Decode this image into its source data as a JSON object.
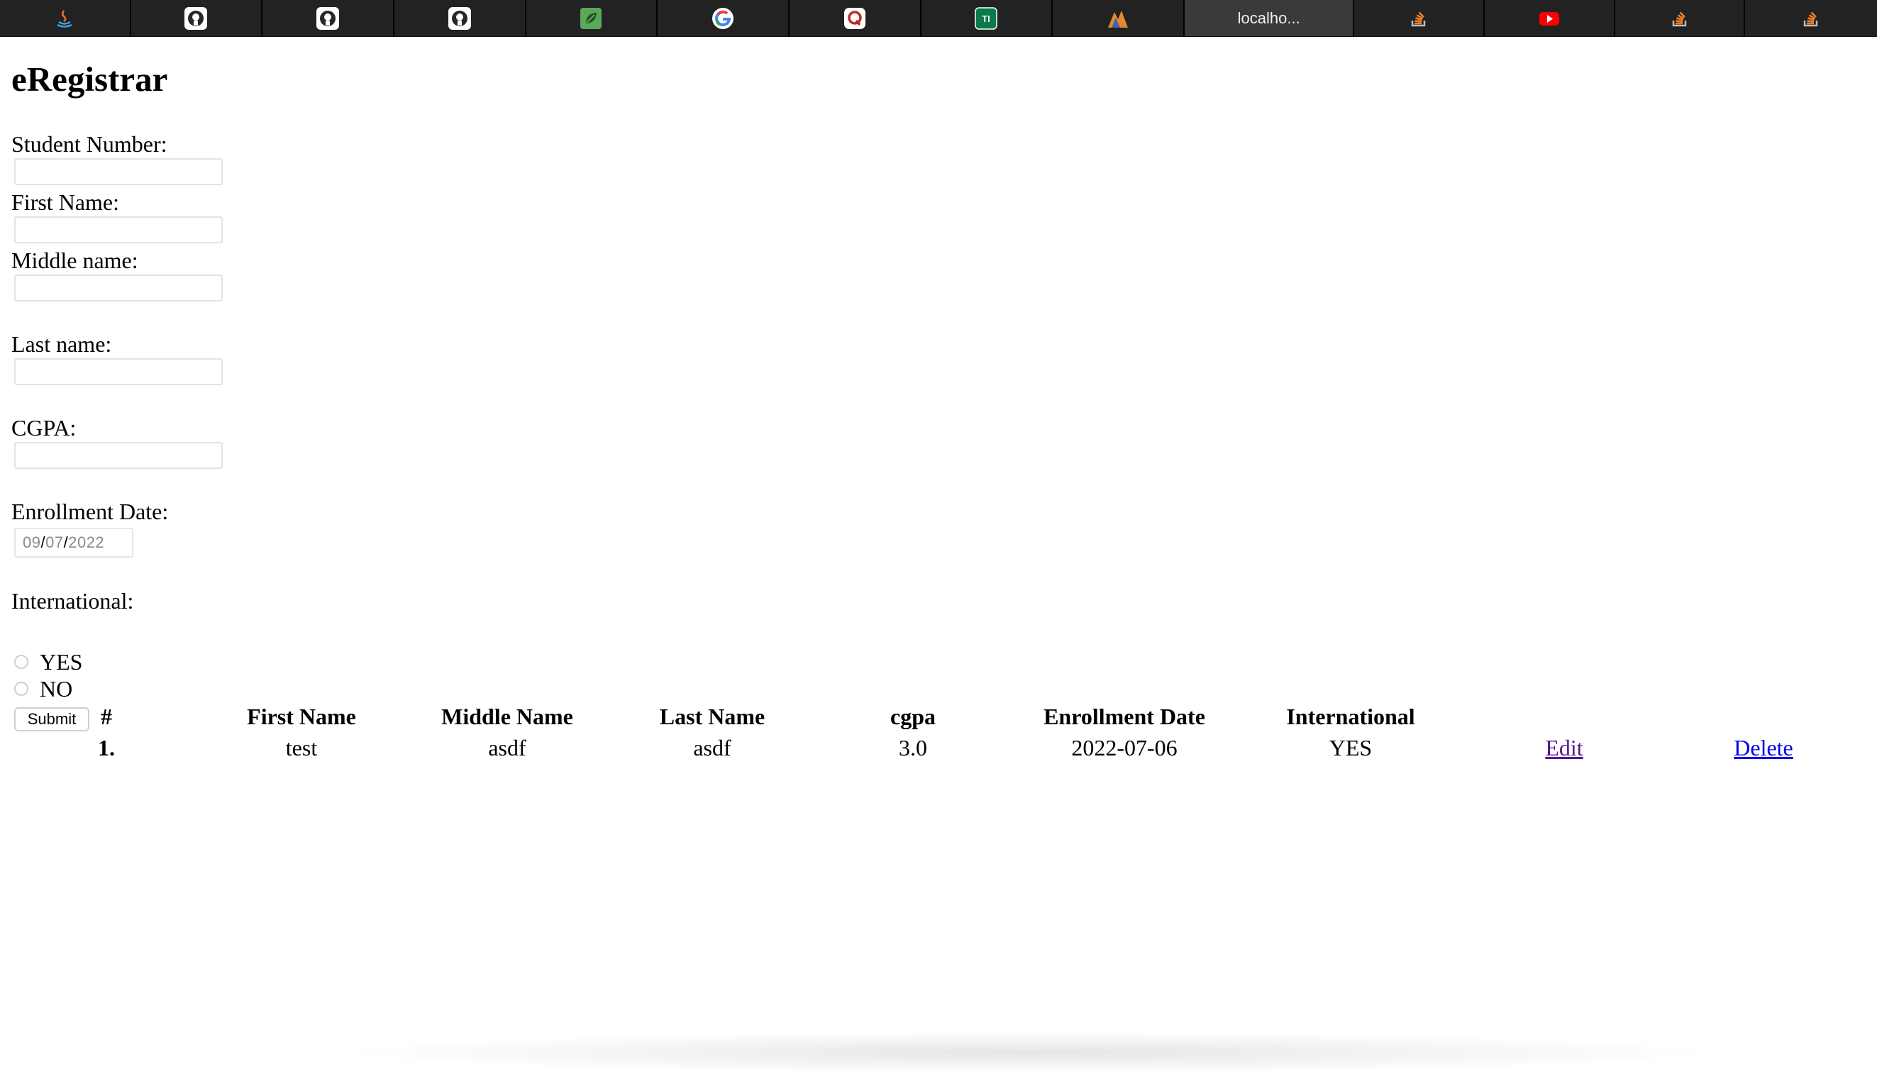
{
  "tabs": [
    {
      "icon": "java-icon",
      "title": ""
    },
    {
      "icon": "github-icon",
      "title": ""
    },
    {
      "icon": "github-icon",
      "title": ""
    },
    {
      "icon": "github-icon",
      "title": ""
    },
    {
      "icon": "spring-leaf-icon",
      "title": ""
    },
    {
      "icon": "google-icon",
      "title": ""
    },
    {
      "icon": "quora-icon",
      "title": ""
    },
    {
      "icon": "ti-icon",
      "title": "TI"
    },
    {
      "icon": "mountain-logo-icon",
      "title": ""
    },
    {
      "icon": "",
      "title": "localho..."
    },
    {
      "icon": "stackoverflow-icon",
      "title": ""
    },
    {
      "icon": "youtube-icon",
      "title": ""
    },
    {
      "icon": "stackoverflow-icon",
      "title": ""
    },
    {
      "icon": "stackoverflow-icon",
      "title": ""
    }
  ],
  "app": {
    "title": "eRegistrar"
  },
  "form": {
    "student_number_label": "Student Number:",
    "first_name_label": "First Name:",
    "middle_name_label": "Middle name:",
    "last_name_label": "Last name:",
    "cgpa_label": "CGPA:",
    "enrollment_date_label": "Enrollment Date:",
    "enrollment_date": {
      "month": "09",
      "day": "07",
      "year": "2022",
      "separator": "/"
    },
    "international_label": "International:",
    "yes_label": "YES",
    "no_label": "NO",
    "submit_label": "Submit"
  },
  "table": {
    "headers": [
      "#",
      "First Name",
      "Middle Name",
      "Last Name",
      "cgpa",
      "Enrollment Date",
      "International"
    ],
    "rows": [
      {
        "num": "1.",
        "first": "test",
        "middle": "asdf",
        "last": "asdf",
        "cgpa": "3.0",
        "date": "2022-07-06",
        "international": "YES",
        "edit": "Edit",
        "delete": "Delete"
      }
    ]
  },
  "colors": {
    "tabbar_bg": "#222222",
    "link_visited": "#551a8b",
    "link": "#0000ee"
  }
}
